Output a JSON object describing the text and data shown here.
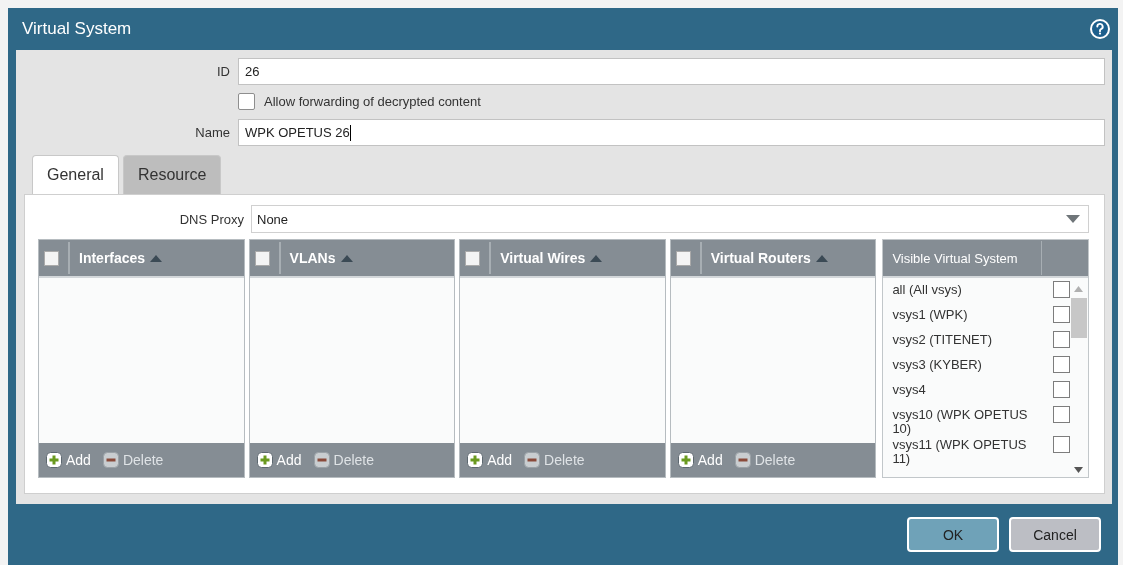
{
  "window": {
    "title": "Virtual System"
  },
  "form": {
    "id": {
      "label": "ID",
      "value": "26"
    },
    "allow_forwarding": {
      "label": "Allow forwarding of decrypted content",
      "checked": false
    },
    "name": {
      "label": "Name",
      "value": "WPK OPETUS 26"
    }
  },
  "tabs": [
    {
      "label": "General",
      "selected": true
    },
    {
      "label": "Resource",
      "selected": false
    }
  ],
  "dns_proxy": {
    "label": "DNS Proxy",
    "value": "None"
  },
  "lists": [
    {
      "title": "Interfaces",
      "checked": false,
      "actions": [
        {
          "kind": "add",
          "label": "Add",
          "disabled": false
        },
        {
          "kind": "delete",
          "label": "Delete",
          "disabled": true
        }
      ]
    },
    {
      "title": "VLANs",
      "checked": false,
      "actions": [
        {
          "kind": "add",
          "label": "Add",
          "disabled": false
        },
        {
          "kind": "delete",
          "label": "Delete",
          "disabled": true
        }
      ]
    },
    {
      "title": "Virtual Wires",
      "checked": false,
      "actions": [
        {
          "kind": "add",
          "label": "Add",
          "disabled": false
        },
        {
          "kind": "delete",
          "label": "Delete",
          "disabled": true
        }
      ]
    },
    {
      "title": "Virtual Routers",
      "checked": false,
      "actions": [
        {
          "kind": "add",
          "label": "Add",
          "disabled": false
        },
        {
          "kind": "delete",
          "label": "Delete",
          "disabled": true
        }
      ]
    }
  ],
  "visible_vsys": {
    "title": "Visible Virtual System",
    "items": [
      {
        "label": "all (All vsys)",
        "checked": false
      },
      {
        "label": "vsys1 (WPK)",
        "checked": false
      },
      {
        "label": "vsys2 (TITENET)",
        "checked": false
      },
      {
        "label": "vsys3 (KYBER)",
        "checked": false
      },
      {
        "label": "vsys4",
        "checked": false
      },
      {
        "label": "vsys10 (WPK OPETUS 10)",
        "checked": false
      },
      {
        "label": "vsys11 (WPK OPETUS 11)",
        "checked": false
      }
    ]
  },
  "buttons": [
    {
      "kind": "primary",
      "label": "OK"
    },
    {
      "kind": "secondary",
      "label": "Cancel"
    }
  ]
}
